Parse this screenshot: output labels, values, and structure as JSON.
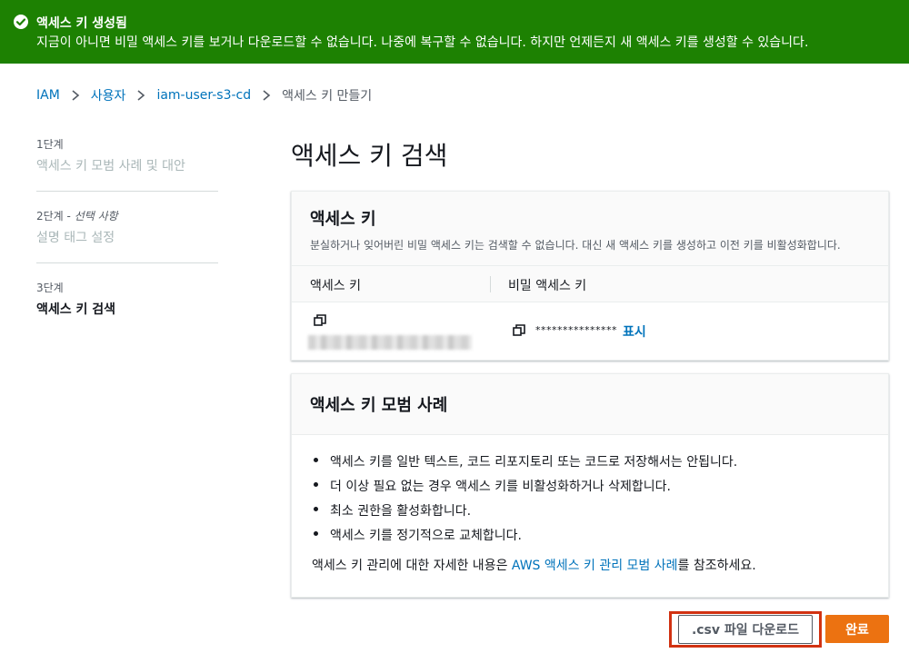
{
  "banner": {
    "title": "액세스 키 생성됨",
    "message": "지금이 아니면 비밀 액세스 키를 보거나 다운로드할 수 없습니다. 나중에 복구할 수 없습니다. 하지만 언제든지 새 액세스 키를 생성할 수 있습니다.",
    "icon": "success-check-icon",
    "color": "#1d8102"
  },
  "breadcrumb": [
    "IAM",
    "사용자",
    "iam-user-s3-cd",
    "액세스 키 만들기"
  ],
  "steps": [
    {
      "number": "1단계",
      "optional": "",
      "name": "액세스 키 모범 사례 및 대안",
      "active": false
    },
    {
      "number": "2단계",
      "optional": "선택 사항",
      "name": "설명 태그 설정",
      "active": false
    },
    {
      "number": "3단계",
      "optional": "",
      "name": "액세스 키 검색",
      "active": true
    }
  ],
  "page_title": "액세스 키 검색",
  "access_key_panel": {
    "title": "액세스 키",
    "description": "분실하거나 잊어버린 비밀 액세스 키는 검색할 수 없습니다. 대신 새 액세스 키를 생성하고 이전 키를 비활성화합니다.",
    "col_access_key": "액세스 키",
    "col_secret_key": "비밀 액세스 키",
    "secret_masked": "***************",
    "show_label": "표시"
  },
  "best_practices_panel": {
    "title": "액세스 키 모범 사례",
    "items": [
      "액세스 키를 일반 텍스트, 코드 리포지토리 또는 코드로 저장해서는 안됩니다.",
      "더 이상 필요 없는 경우 액세스 키를 비활성화하거나 삭제합니다.",
      "최소 권한을 활성화합니다.",
      "액세스 키를 정기적으로 교체합니다."
    ],
    "footer_prefix": "액세스 키 관리에 대한 자세한 내용은 ",
    "footer_link": "AWS 액세스 키 관리 모범 사례",
    "footer_suffix": "를 참조하세요."
  },
  "buttons": {
    "download_csv": ".csv 파일 다운로드",
    "done": "완료"
  },
  "colors": {
    "accent": "#ec7211",
    "link": "#0073bb",
    "highlight_border": "#d13212"
  }
}
